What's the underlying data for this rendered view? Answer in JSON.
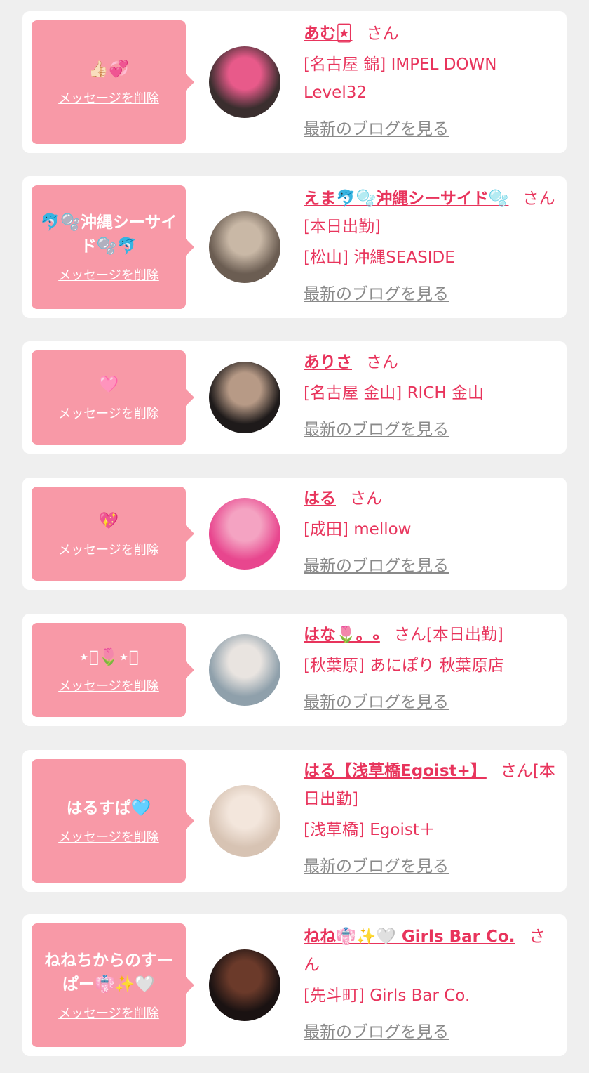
{
  "items": [
    {
      "message": "👍🏻💞",
      "delete_label": "メッセージを削除",
      "name": "あむ🃏",
      "san": "さん",
      "status": "",
      "shop": "[名古屋 錦] IMPEL DOWN Level32",
      "blog_label": "最新のブログを見る",
      "avatar_colors": [
        "#3a2e2e",
        "#e85a8a"
      ]
    },
    {
      "message": "🐬🫧沖縄シーサイド🫧🐬",
      "delete_label": "メッセージを削除",
      "name": "えま🐬🫧沖縄シーサイド🫧",
      "san": "さん",
      "status": "[本日出勤]",
      "shop": "[松山] 沖縄SEASIDE",
      "blog_label": "最新のブログを見る",
      "avatar_colors": [
        "#6b5d52",
        "#c9b8a6"
      ]
    },
    {
      "message": "🩷",
      "delete_label": "メッセージを削除",
      "name": "ありさ",
      "san": "さん",
      "status": "",
      "shop": "[名古屋 金山] RICH 金山",
      "blog_label": "最新のブログを見る",
      "avatar_colors": [
        "#1e1a1a",
        "#b79a86"
      ]
    },
    {
      "message": "💖",
      "delete_label": "メッセージを削除",
      "name": "はる",
      "san": "さん",
      "status": "",
      "shop": "[成田] mellow",
      "blog_label": "最新のブログを見る",
      "avatar_colors": [
        "#e8468e",
        "#f4a3c2"
      ]
    },
    {
      "message": "⋆͛🌷⋆͛",
      "delete_label": "メッセージを削除",
      "name": "はな🌷。ₒ",
      "san": "さん",
      "status": "[本日出勤]",
      "shop": "[秋葉原] あにぽり 秋葉原店",
      "blog_label": "最新のブログを見る",
      "avatar_colors": [
        "#8fa0ab",
        "#e9e4e0"
      ]
    },
    {
      "message": "はるすぱ🩵",
      "delete_label": "メッセージを削除",
      "name": "はる【浅草橋Egoist+】",
      "san": "さん",
      "status": "[本日出勤]",
      "shop": "[浅草橋] Egoist＋",
      "blog_label": "最新のブログを見る",
      "avatar_colors": [
        "#d7c3b3",
        "#f3e6dc"
      ]
    },
    {
      "message": "ねねちからのすーぱー👘✨🤍",
      "delete_label": "メッセージを削除",
      "name": "ねね👘✨🤍 Girls Bar Co.",
      "san": "さん",
      "status": "",
      "shop": "[先斗町] Girls Bar Co.",
      "blog_label": "最新のブログを見る",
      "avatar_colors": [
        "#1a1212",
        "#6b3a2a"
      ]
    }
  ]
}
